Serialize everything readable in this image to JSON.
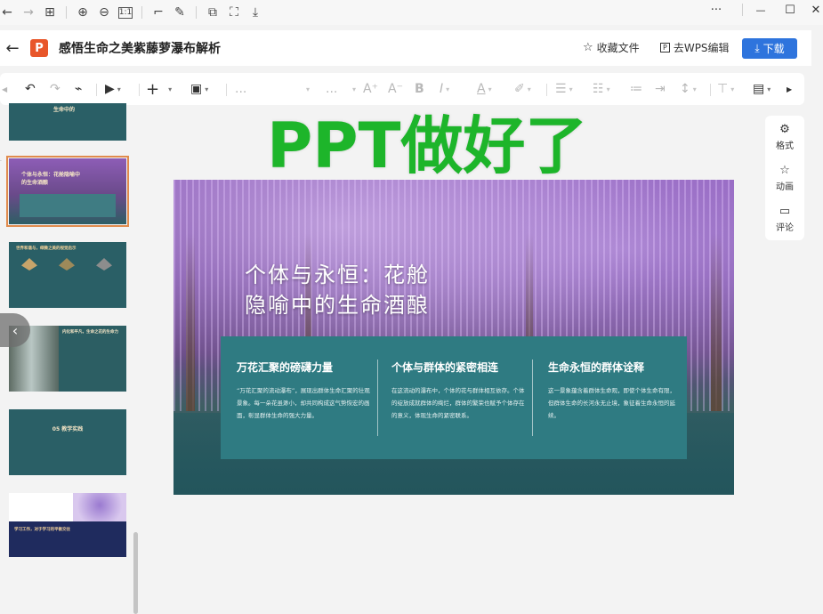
{
  "window": {
    "minimize": "—",
    "maximize": "☐",
    "close": "✕",
    "more": "···"
  },
  "title_bar": {
    "doc_title": "感悟生命之美紫藤萝瀑布解析",
    "collect_label": "收藏文件",
    "wps_edit_label": "去WPS编辑",
    "download_label": "下载"
  },
  "toolbar": {
    "font_placeholder": "...",
    "size_placeholder": "...",
    "font_grow": "A⁺",
    "font_shrink": "A⁻",
    "bold": "B",
    "italic": "I",
    "font_color": "A"
  },
  "right_panel": {
    "format_label": "格式",
    "animation_label": "动画",
    "comment_label": "评论"
  },
  "overlay_text": "PPT做好了",
  "thumbnails": [
    {
      "title": "生命中的",
      "sub": ""
    },
    {
      "title": "个体与永恒：花舱隐喻中的生命酒酿",
      "sub": ""
    },
    {
      "title": "世界和谐与，细微之美的视觉启示",
      "sub": ""
    },
    {
      "title": "内化和平凡，生命之花的生命力",
      "sub": ""
    },
    {
      "title": "05 教学实践",
      "sub": ""
    },
    {
      "title": "学习工作，对于学习的平衡交往",
      "sub": ""
    }
  ],
  "slide": {
    "title_line1": "个体与永恒：花舱",
    "title_line2": "隐喻中的生命酒酿",
    "columns": [
      {
        "heading": "万花汇聚的磅礴力量",
        "body": "“万花汇聚的流动瀑布”，展现出群体生命汇聚的壮观景象。每一朵花虽渺小，却共同构成这气势恢宏的画面，彰显群体生命的强大力量。"
      },
      {
        "heading": "个体与群体的紧密相连",
        "body": "在这流动的瀑布中，个体的花与群体相互依存。个体的绽放成就群体的绚烂，群体的繁荣也赋予个体存在的意义，体现生命的紧密联系。"
      },
      {
        "heading": "生命永恒的群体诠释",
        "body": "这一景象蕴含着群体生命观，即使个体生命有限，但群体生命的长河永无止境，象征着生命永恒的延续。"
      }
    ]
  },
  "colors": {
    "accent_blue": "#2e74dd",
    "overlay_green": "#1db52a",
    "slide_teal": "#2f7b82",
    "selected_thumb": "#e08b4d"
  }
}
